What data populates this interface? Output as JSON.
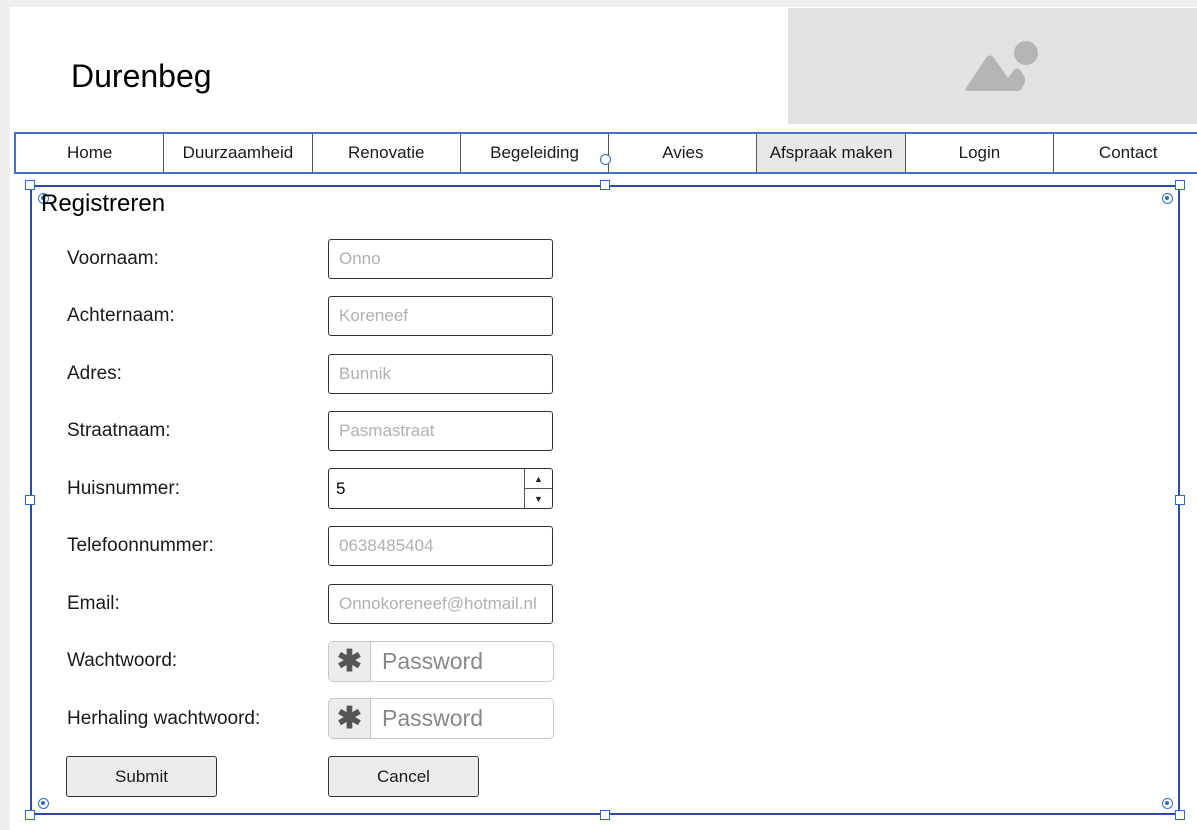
{
  "site": {
    "title": "Durenbeg"
  },
  "nav": {
    "items": [
      "Home",
      "Duurzaamheid",
      "Renovatie",
      "Begeleiding",
      "Avies",
      "Afspraak maken",
      "Login",
      "Contact"
    ],
    "active_index": 5
  },
  "form": {
    "title": "Registreren",
    "fields": {
      "voornaam": {
        "label": "Voornaam:",
        "placeholder": "Onno"
      },
      "achternaam": {
        "label": "Achternaam:",
        "placeholder": "Koreneef"
      },
      "adres": {
        "label": "Adres:",
        "placeholder": "Bunnik"
      },
      "straatnaam": {
        "label": "Straatnaam:",
        "placeholder": "Pasmastraat"
      },
      "huisnummer": {
        "label": "Huisnummer:",
        "value": "5"
      },
      "telefoonnummer": {
        "label": "Telefoonnummer:",
        "placeholder": "0638485404"
      },
      "email": {
        "label": "Email:",
        "placeholder": "Onnokoreneef@hotmail.nl"
      },
      "wachtwoord": {
        "label": "Wachtwoord:",
        "placeholder": "Password"
      },
      "herhaling": {
        "label": "Herhaling wachtwoord:",
        "placeholder": "Password"
      }
    },
    "buttons": {
      "submit": "Submit",
      "cancel": "Cancel"
    }
  },
  "icons": {
    "image_placeholder": "image-icon",
    "password": "asterisk-icon",
    "stepper_up": "triangle-up-icon",
    "stepper_down": "triangle-down-icon"
  },
  "colors": {
    "selection": "#2c4a9e",
    "nav_border": "#4472c4",
    "placeholder_bg": "#e2e2e2",
    "active_nav_bg": "#e8e8e8"
  }
}
